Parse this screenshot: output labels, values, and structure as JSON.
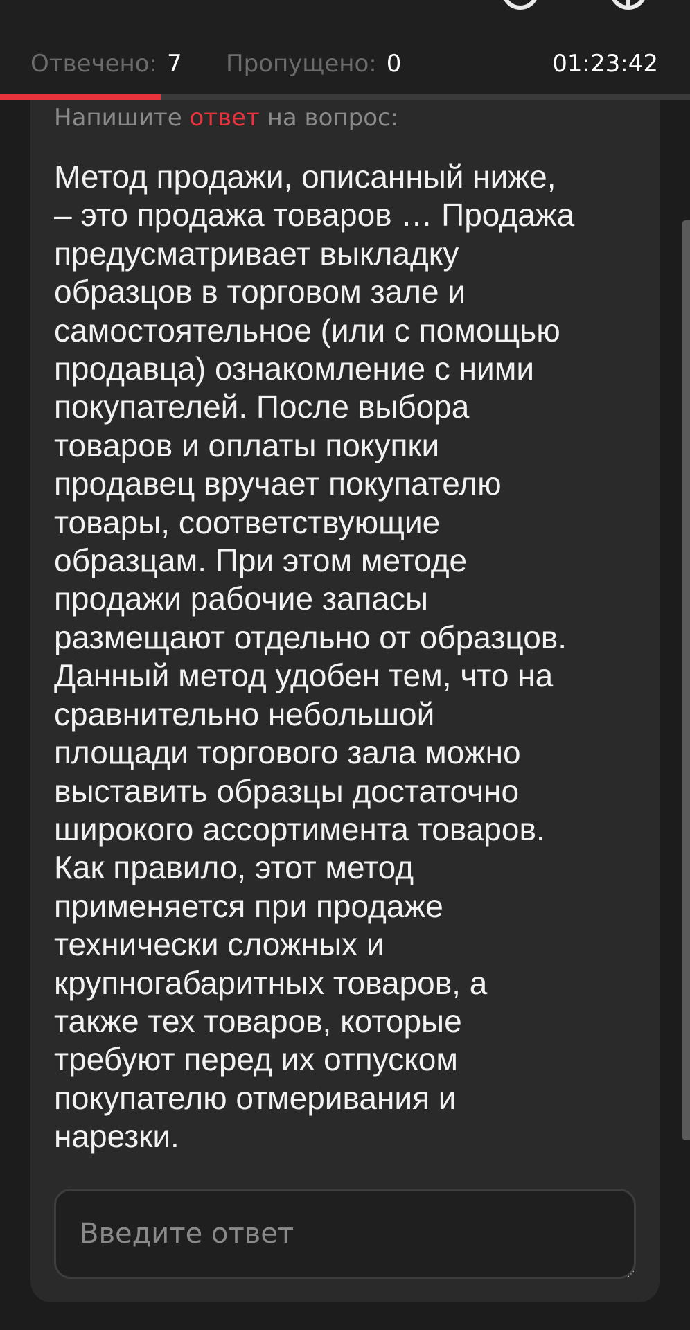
{
  "stats": {
    "answered_label": "Отвечено:",
    "answered_value": "7",
    "skipped_label": "Пропущено:",
    "skipped_value": "0",
    "timer": "01:23:42"
  },
  "progress": {
    "fraction": 0.233,
    "color": "#e8333c"
  },
  "prompt": {
    "before": "Напишите",
    "accent": "ответ",
    "after": "на вопрос:"
  },
  "question_text": "Метод продажи, описанный ниже,\n– это продажа товаров … Продажа\nпредусматривает выкладку\nобразцов в торговом зале и\nсамостоятельное (или с помощью\nпродавца) ознакомление с ними\nпокупателей. После выбора\nтоваров и оплаты покупки\nпродавец вручает покупателю\nтовары, соответствующие\nобразцам. При этом методе\nпродажи рабочие запасы\nразмещают отдельно от образцов.\nДанный метод удобен тем, что на\nсравнительно небольшой\nплощади торгового зала можно\nвыставить образцы достаточно\nширокого ассортимента товаров.\nКак правило, этот метод\nприменяется при продаже\nтехнически сложных и\nкрупногабаритных товаров, а\nтакже тех товаров, которые\nтребуют перед их отпуском\nпокупателю отмеривания и\nнарезки.",
  "answer": {
    "value": "",
    "placeholder": "Введите ответ"
  },
  "colors": {
    "accent": "#e8333c",
    "background": "#1c1c1c",
    "card": "#2a2a2a",
    "muted_text": "#8a8a8a"
  }
}
